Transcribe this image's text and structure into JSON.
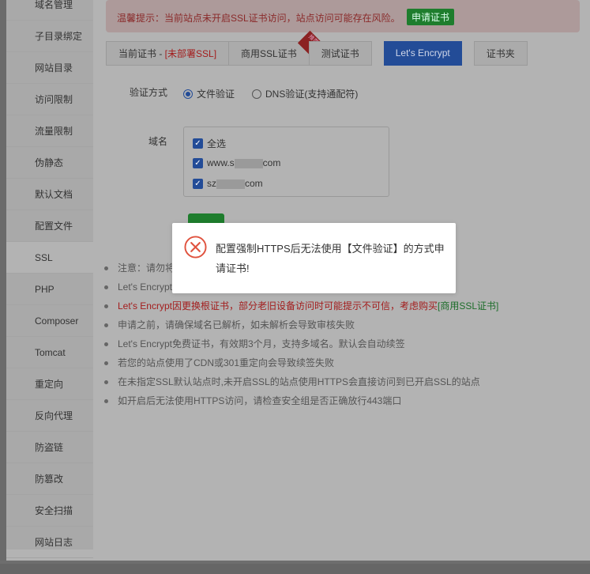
{
  "sidebar": {
    "items": [
      "域名管理",
      "子目录绑定",
      "网站目录",
      "访问限制",
      "流量限制",
      "伪静态",
      "默认文档",
      "配置文件",
      "SSL",
      "PHP",
      "Composer",
      "Tomcat",
      "重定向",
      "反向代理",
      "防盗链",
      "防篡改",
      "安全扫描",
      "网站日志"
    ],
    "active": "SSL"
  },
  "alert": {
    "text": "温馨提示：当前站点未开启SSL证书访问，站点访问可能存在风险。",
    "button": "申请证书"
  },
  "tabs": {
    "current_prefix": "当前证书 - ",
    "current_status": "[未部署SSL]",
    "commercial": "商用SSL证书",
    "commercial_badge": "推荐",
    "test": "测试证书",
    "letsencrypt": "Let's Encrypt",
    "folder": "证书夹"
  },
  "verify": {
    "label": "验证方式",
    "options": [
      "文件验证",
      "DNS验证(支持通配符)"
    ],
    "selected": "文件验证"
  },
  "domains": {
    "label": "域名",
    "select_all": "全选",
    "items": [
      {
        "prefix": "www.s",
        "suffix": "com",
        "checked": true
      },
      {
        "prefix": "sz",
        "suffix": "com",
        "checked": true
      }
    ]
  },
  "notes": {
    "warning": "注意：请勿将",
    "n2": "Let's Encrypt",
    "n3": "Let's Encrypt因更换根证书，部分老旧设备访问时可能提示不可信，考虑购买",
    "n3_link": "[商用SSL证书]",
    "n4": "申请之前，请确保域名已解析，如未解析会导致审核失败",
    "n5": "Let's Encrypt免费证书，有效期3个月，支持多域名。默认会自动续签",
    "n6": "若您的站点使用了CDN或301重定向会导致续签失败",
    "n7": "在未指定SSL默认站点时,未开启SSL的站点使用HTTPS会直接访问到已开启SSL的站点",
    "n8": "如开启后无法使用HTTPS访问，请检查安全组是否正确放行443端口"
  },
  "dialog": {
    "icon": "error-circle-icon",
    "message": "配置强制HTTPS后无法使用【文件验证】的方式申请证书!"
  },
  "colors": {
    "primary": "#234c97",
    "success": "#1e7d2d",
    "danger": "#a31d1d",
    "error_icon": "#e0533f"
  }
}
